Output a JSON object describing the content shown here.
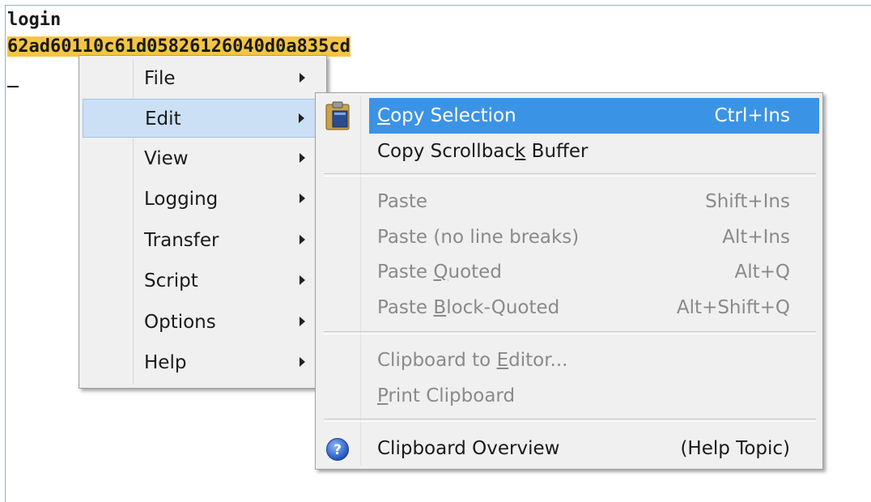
{
  "terminal": {
    "line1": "login",
    "line2": "62ad60110c61d05826126040d0a835cd"
  },
  "main_menu": {
    "items": [
      {
        "label": "File"
      },
      {
        "label": "Edit"
      },
      {
        "label": "View"
      },
      {
        "label": "Logging"
      },
      {
        "label": "Transfer"
      },
      {
        "label": "Script"
      },
      {
        "label": "Options"
      },
      {
        "label": "Help"
      }
    ],
    "active_item": "Edit"
  },
  "edit_submenu": {
    "copy_selection": {
      "pre": "",
      "ul": "C",
      "post": "opy Selection",
      "shortcut": "Ctrl+Ins"
    },
    "copy_scrollback": {
      "pre": "Copy Scrollbac",
      "ul": "k",
      "post": " Buffer"
    },
    "paste": {
      "label": "Paste",
      "shortcut": "Shift+Ins"
    },
    "paste_no_breaks": {
      "label": "Paste (no line breaks)",
      "shortcut": "Alt+Ins"
    },
    "paste_quoted": {
      "pre": "Paste ",
      "ul": "Q",
      "post": "uoted",
      "shortcut": "Alt+Q"
    },
    "paste_block_quoted": {
      "pre": "Paste ",
      "ul": "B",
      "post": "lock-Quoted",
      "shortcut": "Alt+Shift+Q"
    },
    "clipboard_to_editor": {
      "pre": "Clipboard to ",
      "ul": "E",
      "post": "ditor..."
    },
    "print_clipboard": {
      "pre": "",
      "ul": "P",
      "post": "rint Clipboard"
    },
    "clipboard_overview": {
      "label": "Clipboard Overview",
      "shortcut": "(Help Topic)"
    }
  },
  "colors": {
    "selection_highlight": "#f5c542",
    "menu_highlight": "#3b93e6",
    "active_item_bg": "#cce0f5",
    "disabled_text": "#8a8a8a"
  },
  "icons": [
    "clipboard-icon",
    "help-icon",
    "submenu-arrow-icon"
  ]
}
